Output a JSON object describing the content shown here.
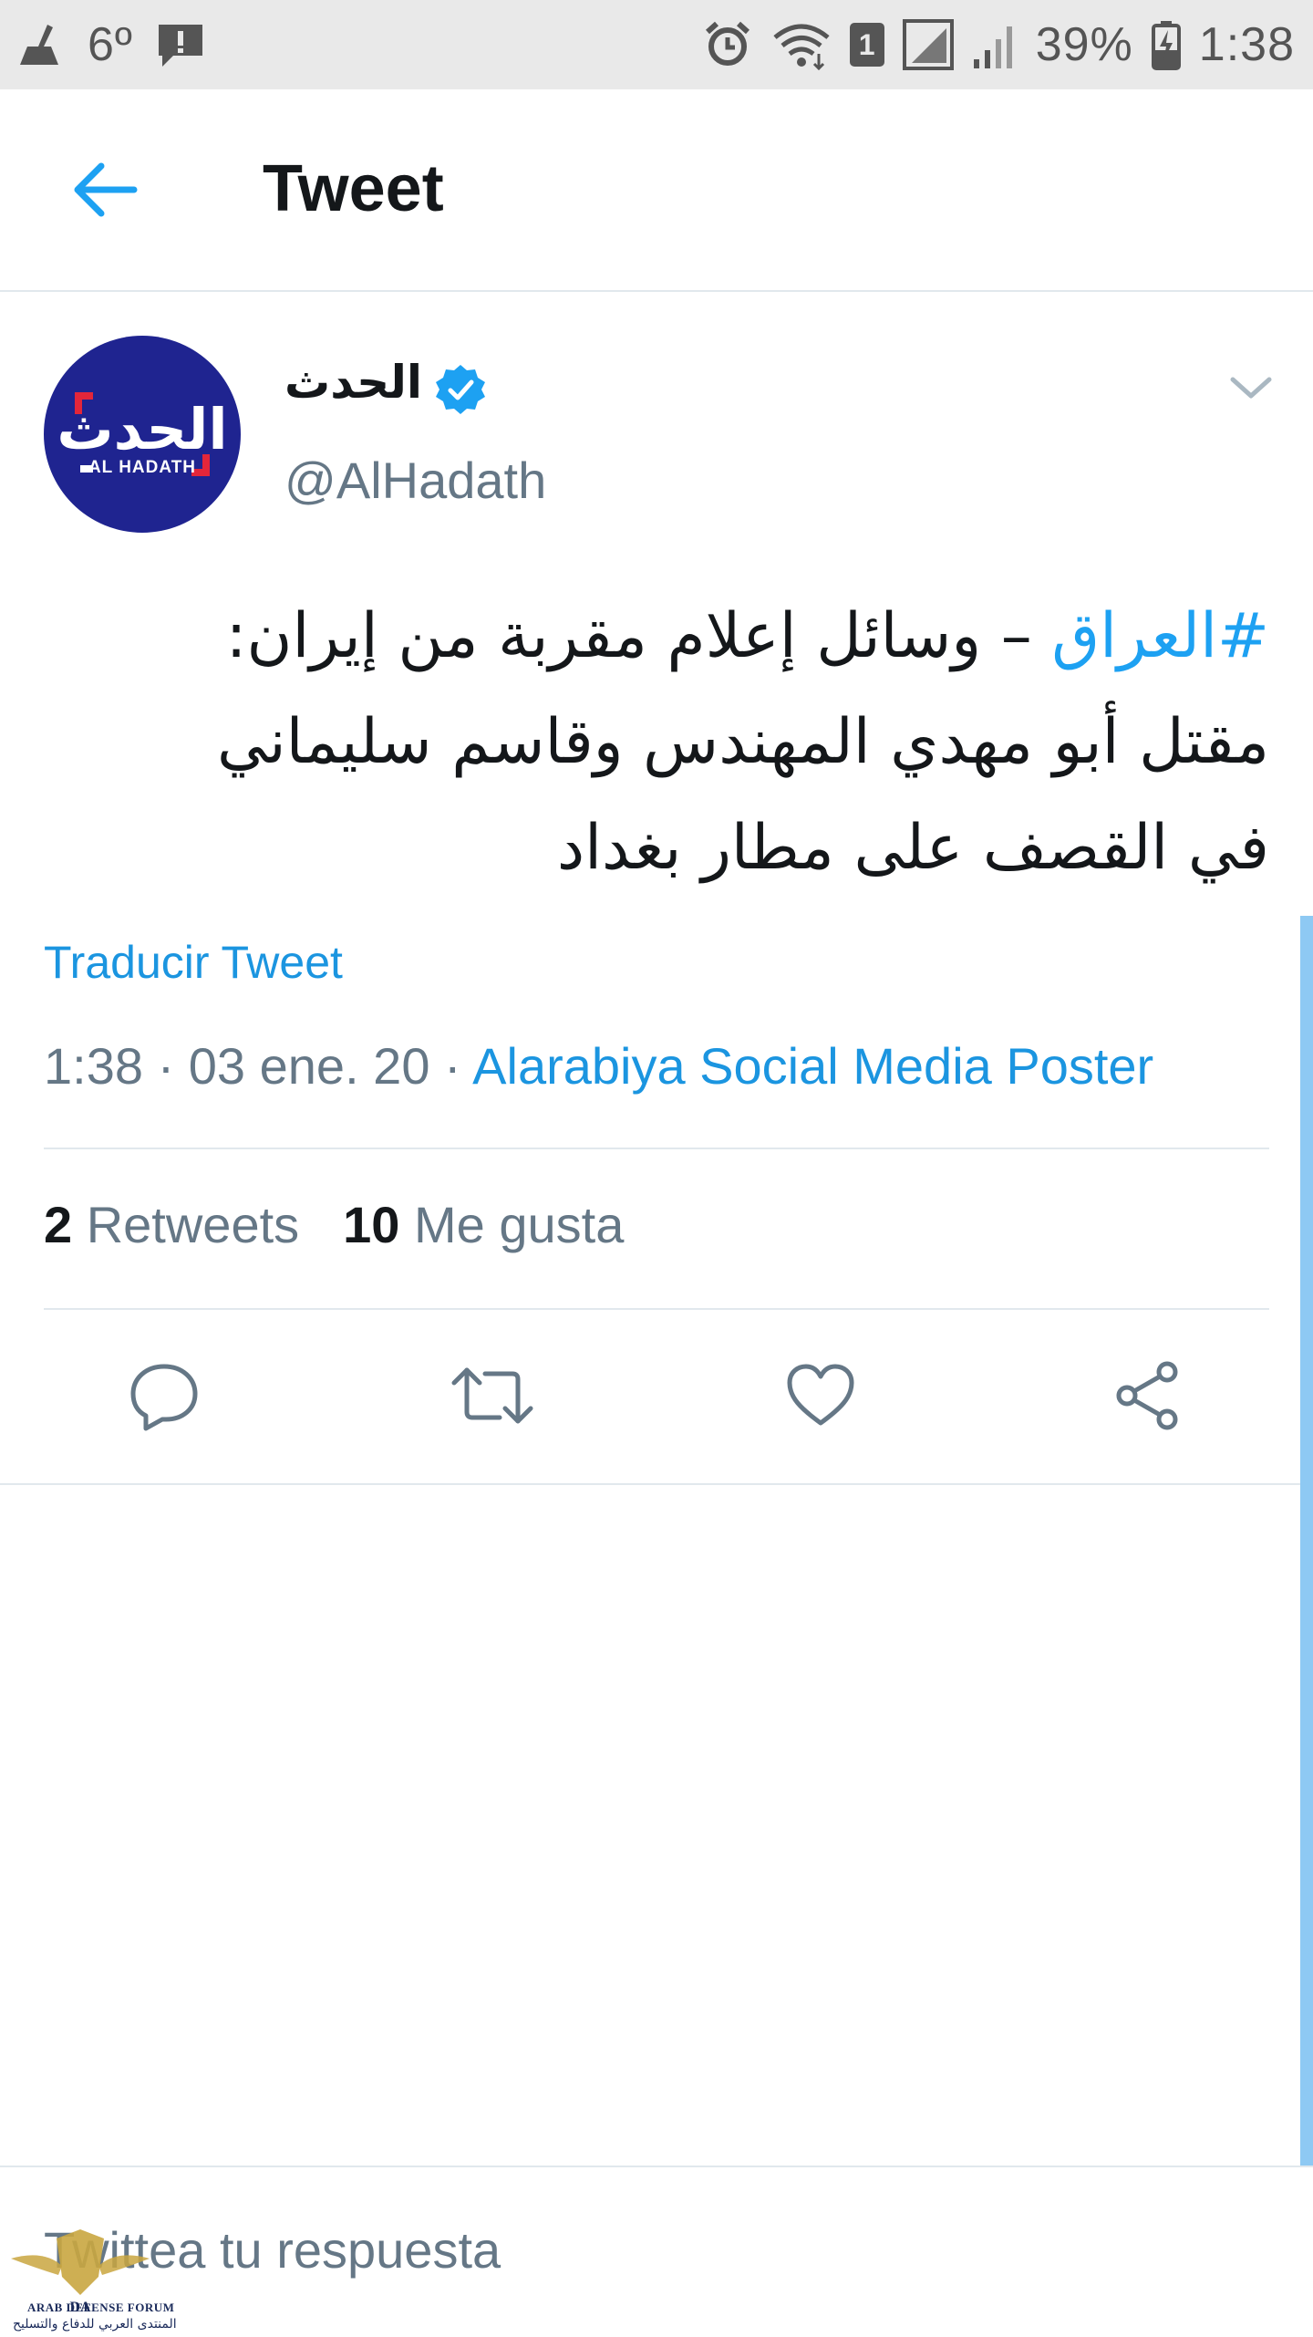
{
  "status_bar": {
    "temperature": "6º",
    "sim_slot": "1",
    "battery_percent": "39%",
    "time": "1:38"
  },
  "header": {
    "title": "Tweet"
  },
  "tweet": {
    "avatar_logo_text": "الحدث",
    "avatar_logo_caption": "AL HADATH",
    "author_name": "الحدث",
    "verified": true,
    "handle": "@AlHadath",
    "hashtag": "#العراق",
    "text_line1_rest": " – وسائل إعلام مقربة من إيران:",
    "text_line2": "مقتل أبو مهدي المهندس وقاسم سليماني",
    "text_line3": "في القصف على مطار بغداد",
    "translate_label": "Traducir Tweet",
    "time": "1:38",
    "date": "03 ene. 20",
    "separator": "·",
    "source": "Alarabiya Social Media Poster",
    "retweets_count": "2",
    "retweets_label": "Retweets",
    "likes_count": "10",
    "likes_label": "Me gusta"
  },
  "actions": [
    {
      "icon": "reply-icon"
    },
    {
      "icon": "retweet-icon"
    },
    {
      "icon": "like-icon"
    },
    {
      "icon": "share-icon"
    }
  ],
  "reply": {
    "placeholder": "Twittea tu respuesta"
  },
  "watermark": {
    "abbr": "DA",
    "name_en": "ARAB DEFENSE FORUM",
    "name_ar": "المنتدى العربي للدفاع والتسليح"
  },
  "colors": {
    "accent": "#1da1f2",
    "link": "#1b95e0",
    "muted": "#657786",
    "avatar_bg": "#1f2490",
    "status_bar_bg": "#e9e9e9"
  }
}
